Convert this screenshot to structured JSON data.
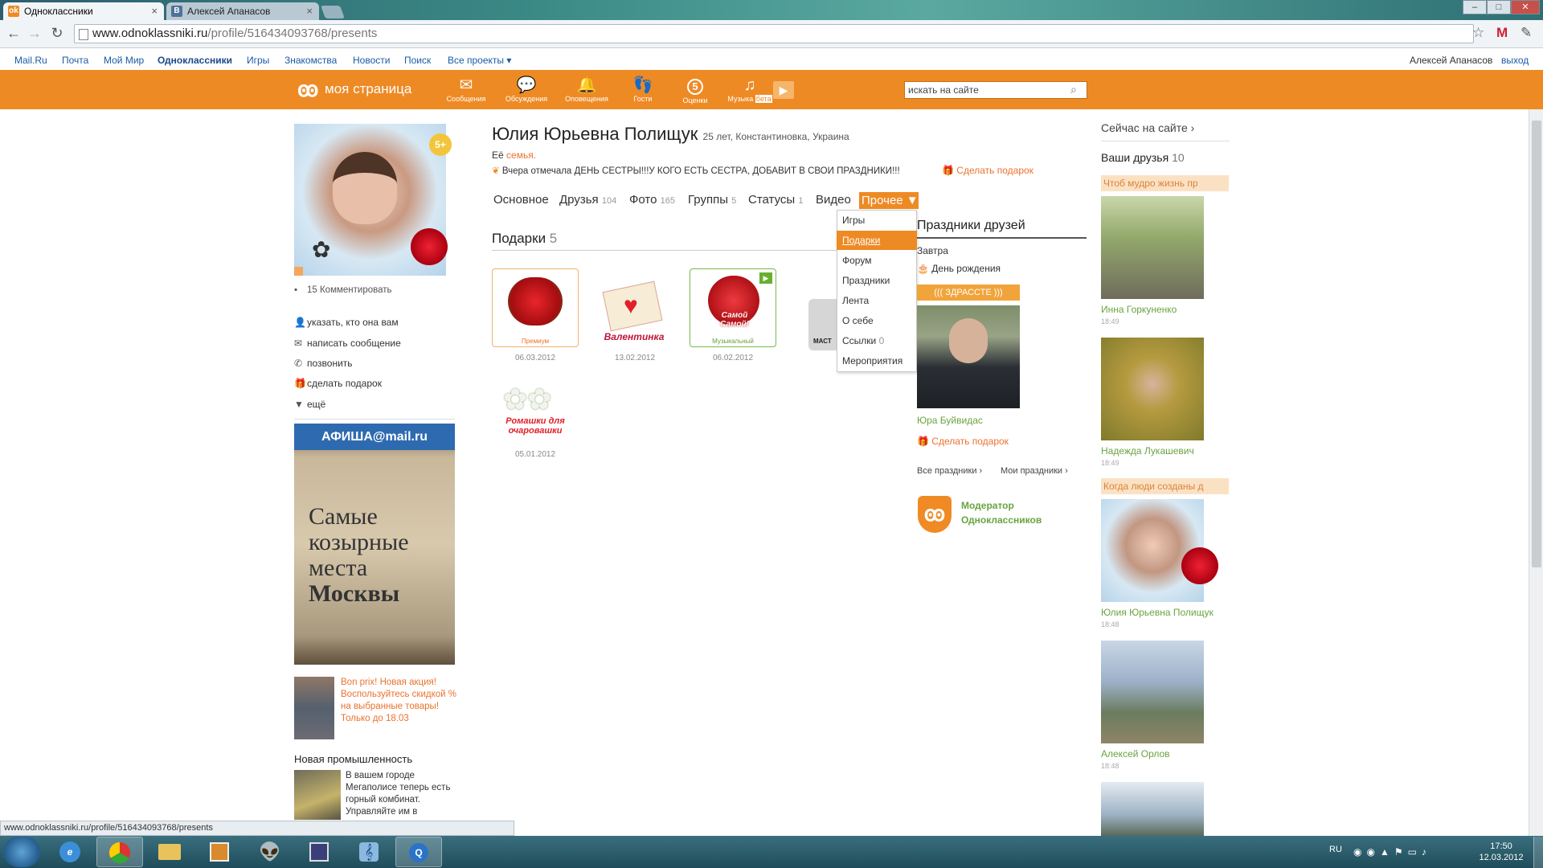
{
  "browser": {
    "tabs": [
      {
        "title": "Одноклассники",
        "favicon": "odnoklassniki-icon"
      },
      {
        "title": "Алексей Апанасов",
        "favicon": "vk-icon"
      }
    ],
    "url_host": "www.odnoklassniki.ru",
    "url_path": "/profile/516434093768/presents",
    "status_url": "www.odnoklassniki.ru/profile/516434093768/presents"
  },
  "mailru_bar": {
    "links": [
      "Mail.Ru",
      "Почта",
      "Мой Мир",
      "Одноклассники",
      "Игры",
      "Знакомства",
      "Новости",
      "Поиск",
      "Все проекты"
    ],
    "user": "Алексей Апанасов",
    "logout": "выход"
  },
  "ok_bar": {
    "my_page": "моя страница",
    "icons": [
      {
        "label": "Сообщения",
        "icon": "envelope-icon"
      },
      {
        "label": "Обсуждения",
        "icon": "chat-bubbles-icon"
      },
      {
        "label": "Оповещения",
        "icon": "bell-icon"
      },
      {
        "label": "Гости",
        "icon": "footprints-icon"
      },
      {
        "label": "Оценки",
        "icon": "rating-five-icon",
        "badge": "5"
      },
      {
        "label": "Музыка",
        "icon": "music-note-icon",
        "beta": "бета"
      }
    ],
    "search_value": "искать на сайте"
  },
  "profile": {
    "name": "Юлия Юрьевна Полищук",
    "info": "25 лет, Константиновка, Украина",
    "family_prefix": "Её",
    "family_link": "семья.",
    "status": "Вчера отмечала ДЕНЬ СЕСТРЫ!!!У КОГО ЕСТЬ СЕСТРА, ДОБАВИТ В СВОИ ПРАЗДНИКИ!!!",
    "make_gift": "Сделать подарок",
    "avatar_badge": "5+",
    "comments": "15 Комментировать",
    "actions": [
      {
        "label": "указать, кто она вам",
        "icon": "person-icon"
      },
      {
        "label": "написать сообщение",
        "icon": "envelope-icon"
      },
      {
        "label": "позвонить",
        "icon": "phone-icon"
      },
      {
        "label": "сделать подарок",
        "icon": "gift-icon"
      },
      {
        "label": "ещё",
        "icon": "triangle-down-icon"
      }
    ]
  },
  "nav": {
    "items": [
      {
        "label": "Основное",
        "count": ""
      },
      {
        "label": "Друзья",
        "count": "104"
      },
      {
        "label": "Фото",
        "count": "165"
      },
      {
        "label": "Группы",
        "count": "5"
      },
      {
        "label": "Статусы",
        "count": "1"
      },
      {
        "label": "Видео",
        "count": ""
      }
    ],
    "more": "Прочее ▼",
    "dropdown": [
      {
        "label": "Игры",
        "count": ""
      },
      {
        "label": "Подарки",
        "count": "",
        "active": true
      },
      {
        "label": "Форум",
        "count": ""
      },
      {
        "label": "Праздники",
        "count": ""
      },
      {
        "label": "Лента",
        "count": ""
      },
      {
        "label": "О себе",
        "count": ""
      },
      {
        "label": "Ссылки",
        "count": "0"
      },
      {
        "label": "Мероприятия",
        "count": ""
      }
    ]
  },
  "gifts": {
    "title": "Подарки",
    "count": "5",
    "items": [
      {
        "tag": "Премиум",
        "date": "06.03.2012",
        "caption": ""
      },
      {
        "tag": "",
        "date": "13.02.2012",
        "caption": "Валентинка"
      },
      {
        "tag": "Музыкальный",
        "date": "06.02.2012",
        "caption": "Самой Самой!"
      },
      {
        "tag": "",
        "date": "05.01.2012",
        "caption": "Ромашки для очаровашки"
      }
    ],
    "partial_label": "МАСТ"
  },
  "holidays": {
    "title": "Праздники друзей",
    "when": "Завтра",
    "type": "День рождения",
    "banner": "((( ЗДРАССТЕ )))",
    "friend": "Юра Буйвидас",
    "gift": "Сделать подарок",
    "all": "Все праздники ›",
    "mine": "Мои праздники ›",
    "moderator": "Модератор Одноклассников"
  },
  "ads": {
    "afisha_logo": "АФИША@mail.ru",
    "afisha_text_1": "Самые",
    "afisha_text_2": "козырные",
    "afisha_text_3": "места",
    "afisha_text_4": "Москвы",
    "bonprix": "Bon prix! Новая акция! Воспользуйтесь скидкой % на выбранные товары! Только до 18.03",
    "news_title": "Новая промышленность",
    "news_text": "В вашем городе Мегаполисе теперь есть горный комбинат. Управляйте им в"
  },
  "right": {
    "online": "Сейчас на сайте ›",
    "friends_title": "Ваши друзья",
    "friends_count": "10",
    "friends": [
      {
        "quote": "Чтоб мудро жизнь пр",
        "name": "Инна Горкуненко",
        "time": "18:49"
      },
      {
        "quote": "",
        "name": "Надежда Лукашевич",
        "time": "18:49"
      },
      {
        "quote": "Когда люди созданы д",
        "name": "Юлия Юрьевна Полищук",
        "time": "18:48"
      },
      {
        "quote": "",
        "name": "Алексей Орлов",
        "time": "18:48"
      }
    ]
  },
  "taskbar": {
    "lang": "RU",
    "time": "17:50",
    "date": "12.03.2012"
  },
  "colors": {
    "accent": "#ee8a24",
    "link": "#eb722e",
    "green": "#6aa340"
  }
}
